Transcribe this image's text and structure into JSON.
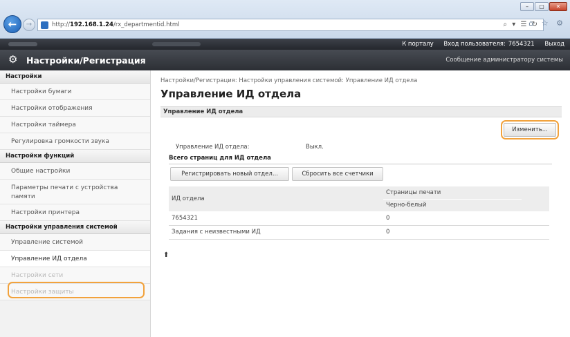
{
  "browser": {
    "url_prefix": "http://",
    "url_host": "192.168.1.24",
    "url_path": "/rx_departmentid.html",
    "tool_glyphs": "⌕ ▾ ☰ ↻",
    "nav_glyphs": "⌂ ☆ ⚙",
    "window_buttons": [
      "–",
      "▢",
      "✕"
    ]
  },
  "topbar": {
    "links": [
      "К порталу",
      "Вход пользователя:",
      "7654321",
      "Выход"
    ]
  },
  "header": {
    "title": "Настройки/Регистрация",
    "message_link": "Сообщение администратору системы"
  },
  "sidebar": {
    "sections": [
      {
        "heading": "Настройки",
        "items": [
          "Настройки бумаги",
          "Настройки отображения",
          "Настройки таймера",
          "Регулировка громкости звука"
        ]
      },
      {
        "heading": "Настройки функций",
        "items": [
          "Общие настройки",
          "Параметры печати с устройства памяти",
          "Настройки принтера"
        ]
      },
      {
        "heading": "Настройки управления системой",
        "items": [
          "Управление системой",
          "Управление ИД отдела",
          "Настройки сети",
          "Настройки защиты"
        ]
      }
    ]
  },
  "main": {
    "breadcrumb": "Настройки/Регистрация: Настройки управления системой: Управление ИД отдела",
    "title": "Управление ИД отдела",
    "section_title": "Управление ИД отдела",
    "edit_button": "Изменить...",
    "status_label": "Управление ИД отдела:",
    "status_value": "Выкл.",
    "total_pages_heading": "Всего страниц для ИД отдела",
    "register_button": "Регистрировать новый отдел...",
    "reset_button": "Сбросить все счетчики",
    "table": {
      "col_dept": "ИД отдела",
      "col_pages": "Страницы печати",
      "col_bw": "Черно-белый",
      "rows": [
        {
          "dept": "7654321",
          "bw": "0"
        },
        {
          "dept": "Задания с неизвестными ИД",
          "bw": "0"
        }
      ]
    },
    "back_to_top_glyph": "⬆"
  },
  "colors": {
    "highlight": "#f2a23c",
    "header_dark": "#2c2f35",
    "browser_back": "#1b5fb5"
  }
}
